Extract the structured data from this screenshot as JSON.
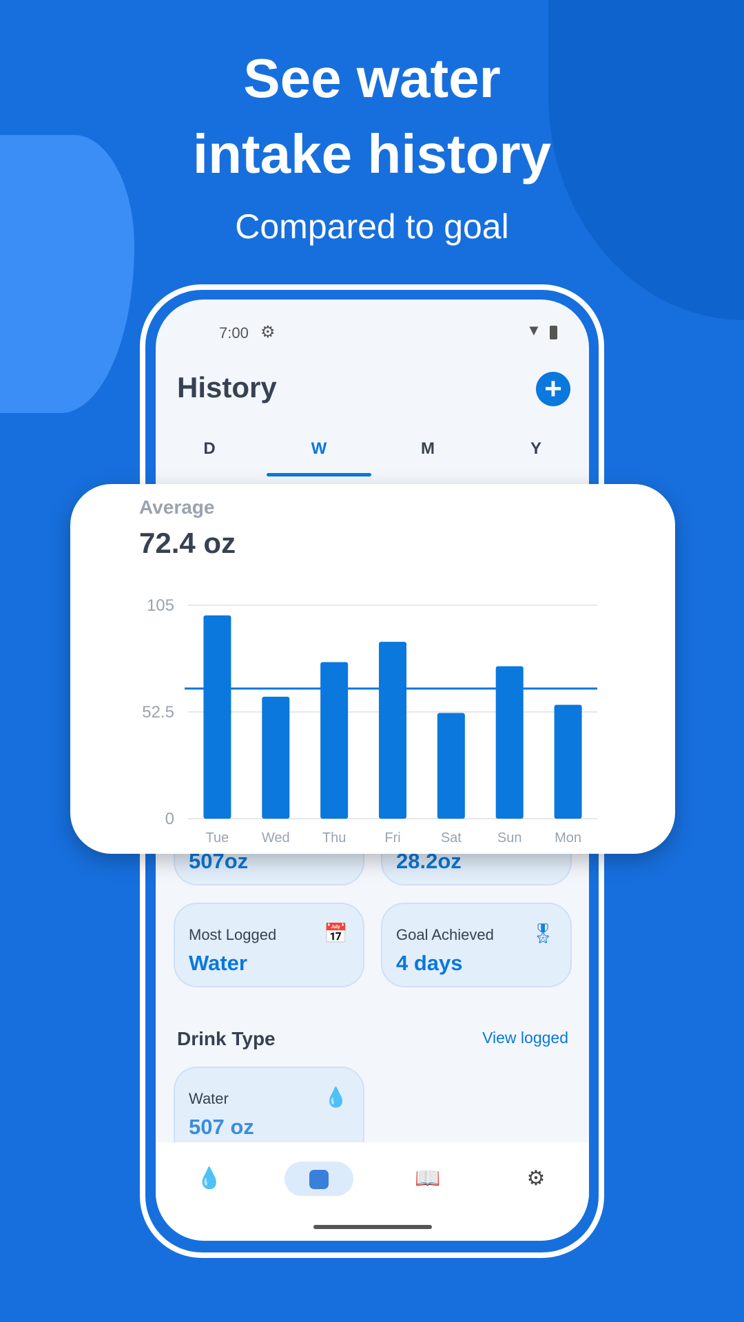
{
  "headline": {
    "line1": "See water",
    "line2": "intake history",
    "subtitle": "Compared to goal"
  },
  "status": {
    "time": "7:00"
  },
  "header": {
    "title": "History",
    "add_icon": "plus-circle-icon"
  },
  "tabs": [
    {
      "label": "D"
    },
    {
      "label": "W",
      "active": true
    },
    {
      "label": "M"
    },
    {
      "label": "Y"
    }
  ],
  "summary": {
    "average_label": "Average",
    "average_value": "72.4 oz"
  },
  "chart_data": {
    "type": "bar",
    "categories": [
      "Tue",
      "Wed",
      "Thu",
      "Fri",
      "Sat",
      "Sun",
      "Mon"
    ],
    "values": [
      100,
      60,
      77,
      87,
      52,
      75,
      56
    ],
    "ylim": [
      0,
      105
    ],
    "yticks": [
      "0",
      "52.5",
      "105"
    ],
    "goal_line": 64,
    "grid": true,
    "bar_color": "#0A78DC"
  },
  "stats": [
    {
      "value": "507oz"
    },
    {
      "value": "28.2oz"
    },
    {
      "label": "Most Logged",
      "value": "Water",
      "icon": "calendar-check-icon"
    },
    {
      "label": "Goal Achieved",
      "value": "4 days",
      "icon": "award-icon"
    }
  ],
  "drink_type": {
    "title": "Drink Type",
    "link": "View logged",
    "items": [
      {
        "label": "Water",
        "value": "507 oz",
        "icon": "water-drop-icon"
      }
    ]
  },
  "nav": [
    "water-drop-icon",
    "chart-icon",
    "book-icon",
    "gear-icon"
  ],
  "colors": {
    "background": "#176FDD",
    "accent": "#0A78DC"
  }
}
